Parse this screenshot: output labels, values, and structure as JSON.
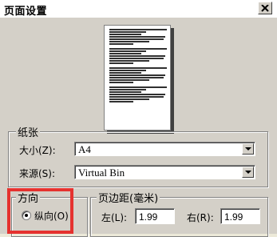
{
  "dialog": {
    "title": "页面设置"
  },
  "paper": {
    "group_label": "纸张",
    "size_label": "大小(Z):",
    "size_value": "A4",
    "source_label": "来源(S):",
    "source_value": "Virtual Bin"
  },
  "orientation": {
    "group_label": "方向",
    "portrait_label": "纵向(O)",
    "portrait_selected": true
  },
  "margins": {
    "group_label": "页边距(毫米)",
    "left_label": "左(L):",
    "left_value": "1.99",
    "right_label": "右(R):",
    "right_value": "1.99"
  },
  "annotations": {
    "highlight_color": "#e5322f"
  }
}
